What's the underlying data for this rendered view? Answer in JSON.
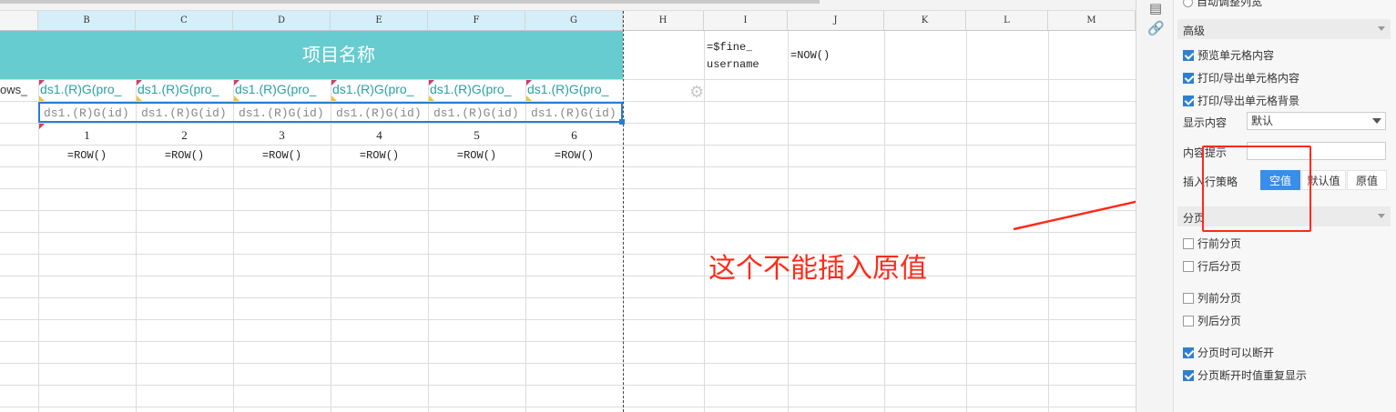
{
  "columns": [
    "",
    "B",
    "C",
    "D",
    "E",
    "F",
    "G",
    "H",
    "I",
    "J",
    "K",
    "L",
    "M"
  ],
  "sheet": {
    "title": "项目名称",
    "row_label_partial": "ows_",
    "ds_header": [
      "ds1.(R)G(pro_",
      "ds1.(R)G(pro_",
      "ds1.(R)G(pro_",
      "ds1.(R)G(pro_",
      "ds1.(R)G(pro_",
      "ds1.(R)G(pro_"
    ],
    "ds_detail": [
      "ds1.(R)G(id)",
      "ds1.(R)G(id)",
      "ds1.(R)G(id)",
      "ds1.(R)G(id)",
      "ds1.(R)G(id)",
      "ds1.(R)G(id)"
    ],
    "numbers": [
      "1",
      "2",
      "3",
      "4",
      "5",
      "6"
    ],
    "row_formulas": [
      "=ROW()",
      "=ROW()",
      "=ROW()",
      "=ROW()",
      "=ROW()",
      "=ROW()"
    ],
    "i_cell_line1": "=$fine_",
    "i_cell_line2": "username",
    "j_cell": "=NOW()",
    "annotation": "这个不能插入原值"
  },
  "panel": {
    "auto_width_partial": "自动调整列宽",
    "advanced_section": "高级",
    "preview_cell": "预览单元格内容",
    "print_cell": "打印/导出单元格内容",
    "print_bg": "打印/导出单元格背景",
    "display_label": "显示内容",
    "display_value": "默认",
    "tip_label": "内容提示",
    "insert_label": "插入行策略",
    "insert_options": [
      "空值",
      "默认值",
      "原值"
    ],
    "paging_section": "分页",
    "row_before": "行前分页",
    "row_after": "行后分页",
    "col_before": "列前分页",
    "col_after": "列后分页",
    "break_allowed": "分页时可以断开",
    "repeat_on_break": "分页断开时值重复显示"
  },
  "colors": {
    "title_bg": "#66ccd0",
    "teal_text": "#2aa0a4",
    "selection": "#2b7bd3",
    "annotation": "#ff2a1a",
    "active_seg": "#3b8ee6"
  }
}
